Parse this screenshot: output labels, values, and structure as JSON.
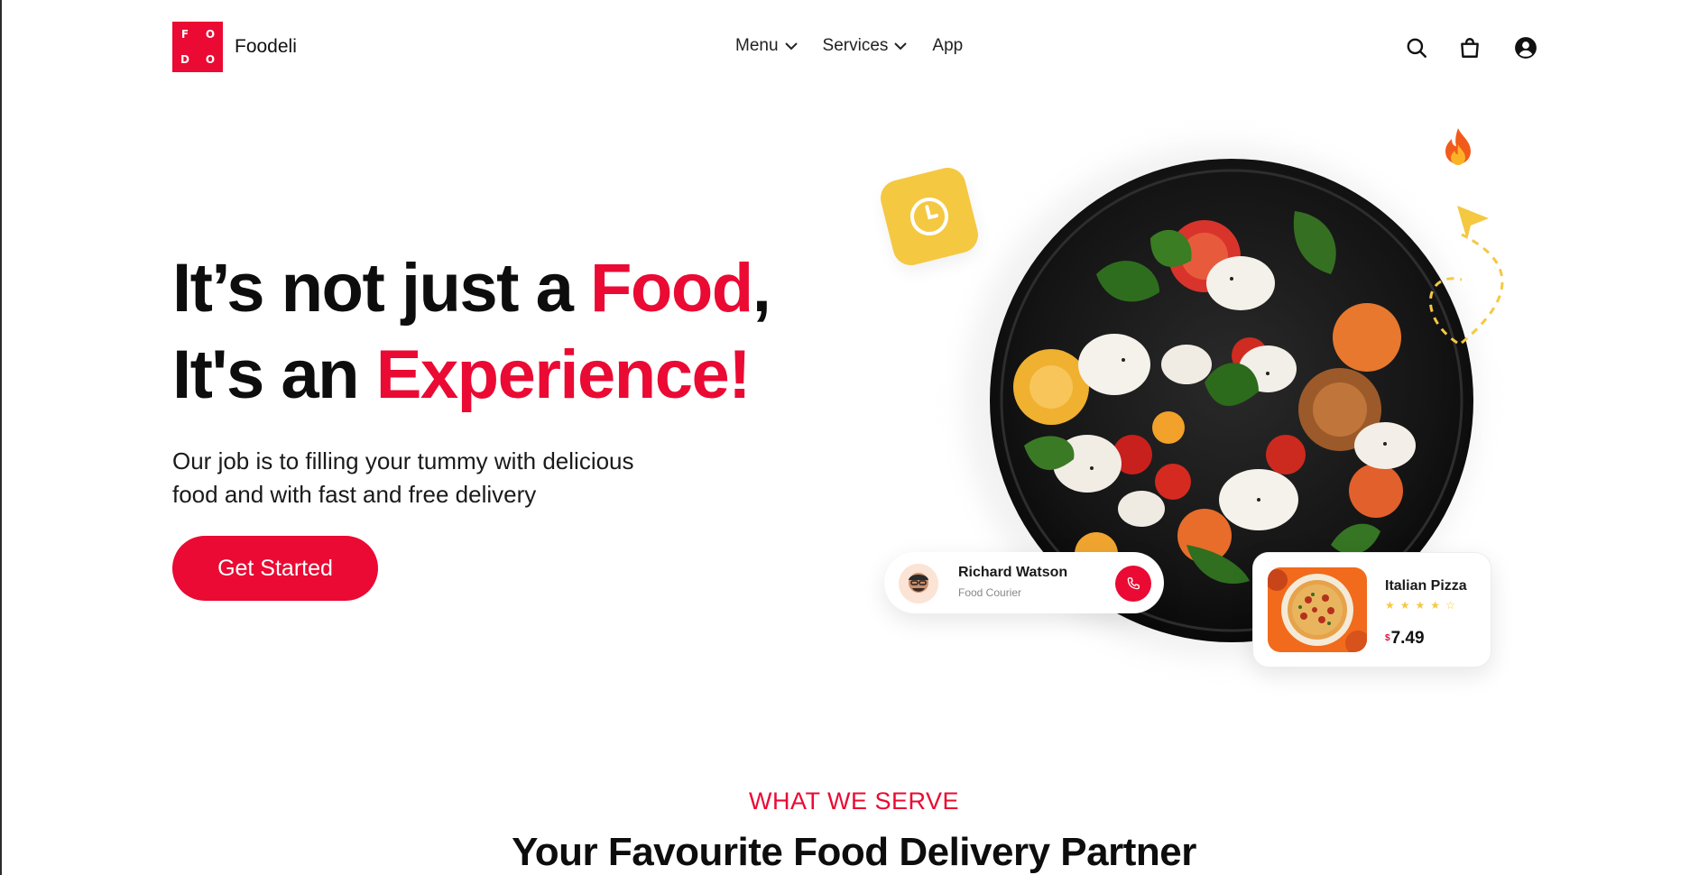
{
  "header": {
    "logo_letters": [
      "F",
      "O",
      "D",
      "O"
    ],
    "brand": "Foodeli",
    "nav": [
      {
        "label": "Menu",
        "has_dropdown": true
      },
      {
        "label": "Services",
        "has_dropdown": true
      },
      {
        "label": "App",
        "has_dropdown": false
      }
    ],
    "icons": [
      "search-icon",
      "shopping-bag-icon",
      "user-account-icon"
    ]
  },
  "hero": {
    "line1_pre": "It’s not just a ",
    "line1_accent": "Food",
    "line1_post": ",",
    "line2_pre": "It's an ",
    "line2_accent": "Experience!",
    "subtext_line1": "Our job is to filling your tummy with delicious",
    "subtext_line2": "food and with fast and free delivery",
    "cta_label": "Get Started"
  },
  "courier_card": {
    "name": "Richard Watson",
    "role": "Food Courier"
  },
  "pizza_card": {
    "name": "Italian Pizza",
    "rating": 4,
    "rating_max": 5,
    "currency": "$",
    "price": "7.49"
  },
  "section": {
    "eyebrow": "WHAT WE SERVE",
    "title": "Your Favourite Food Delivery Partner"
  },
  "colors": {
    "accent": "#ea0a33",
    "yellow": "#f5c842",
    "text": "#0d0d0d"
  }
}
